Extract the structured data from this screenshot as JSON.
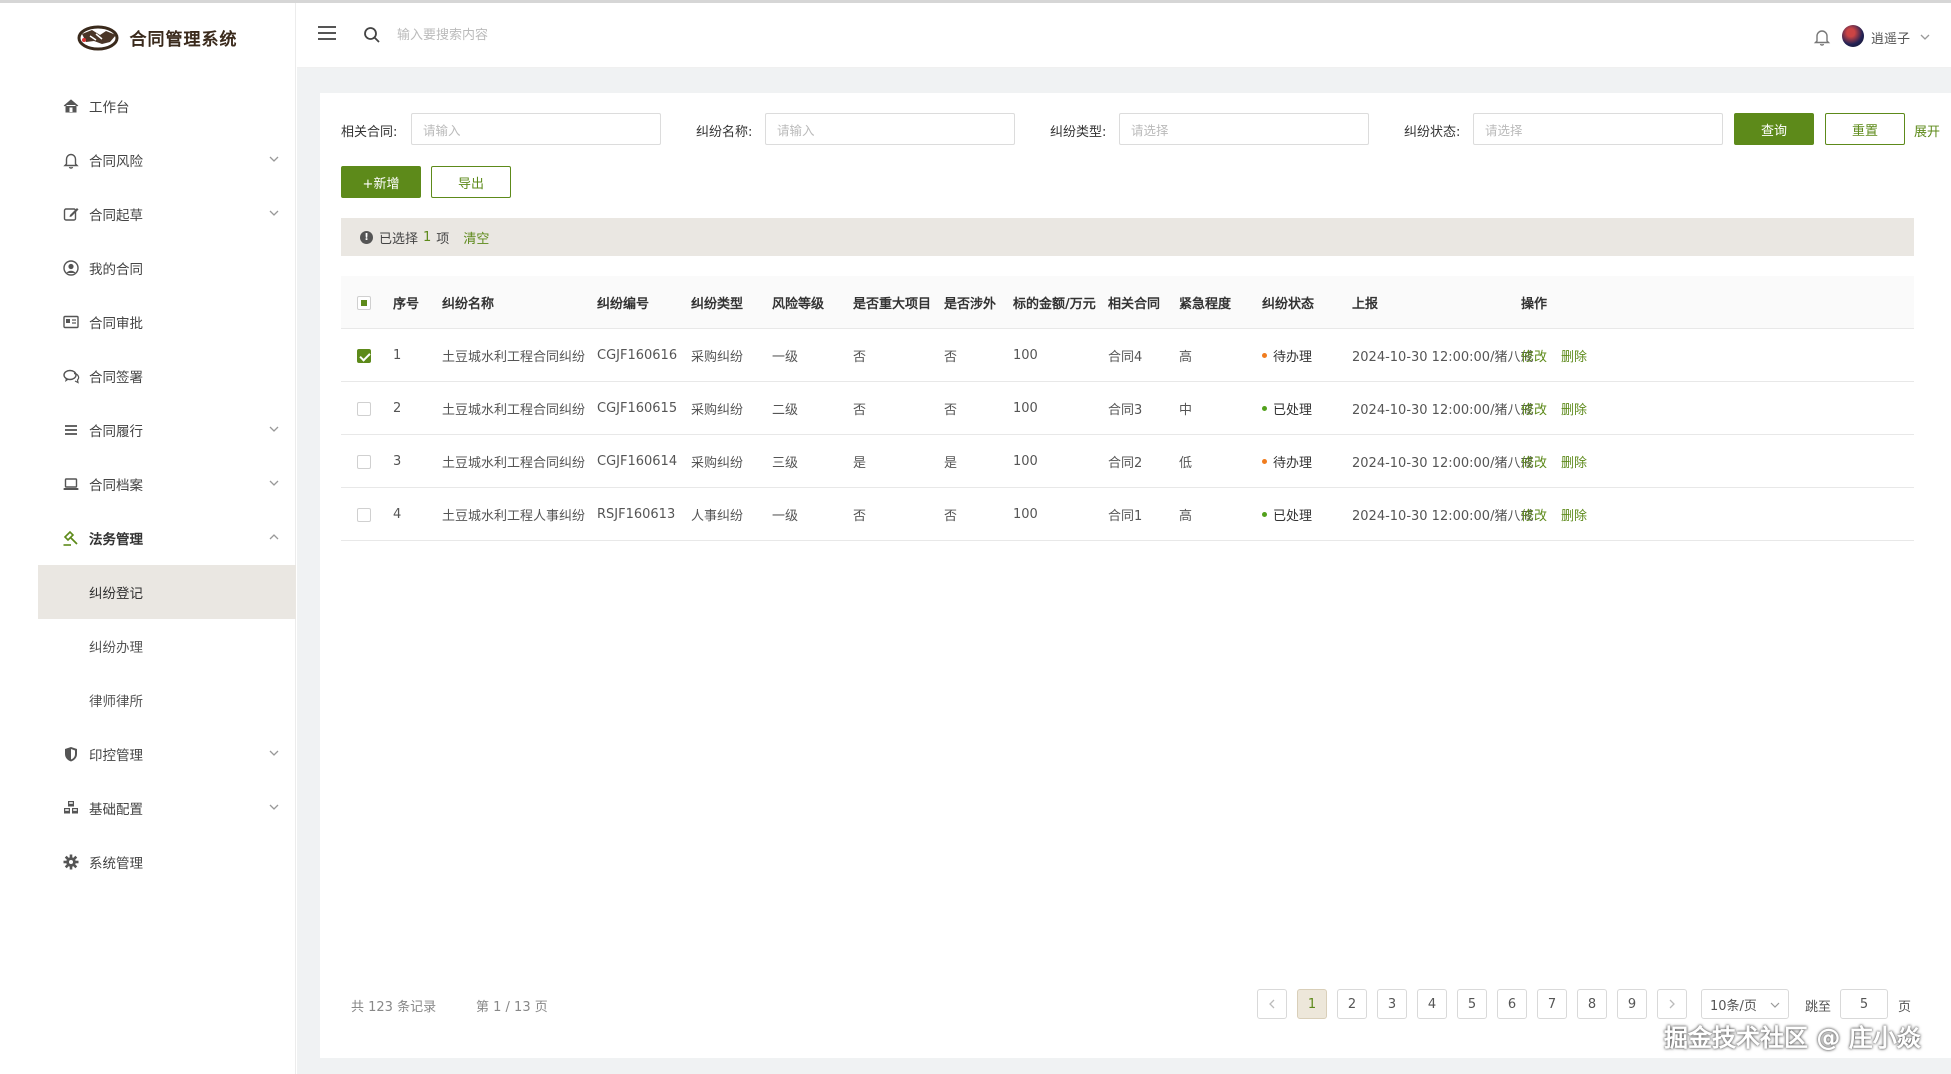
{
  "app": {
    "title": "合同管理系统"
  },
  "header": {
    "search_placeholder": "输入要搜索内容",
    "username": "逍遥子"
  },
  "sidebar": {
    "items": [
      {
        "label": "工作台",
        "icon": "home-icon",
        "expandable": false
      },
      {
        "label": "合同风险",
        "icon": "bell-icon",
        "expandable": true
      },
      {
        "label": "合同起草",
        "icon": "edit-icon",
        "expandable": true
      },
      {
        "label": "我的合同",
        "icon": "user-circle-icon",
        "expandable": false
      },
      {
        "label": "合同审批",
        "icon": "id-card-icon",
        "expandable": false
      },
      {
        "label": "合同签署",
        "icon": "chat-icon",
        "expandable": false
      },
      {
        "label": "合同履行",
        "icon": "list-icon",
        "expandable": true
      },
      {
        "label": "合同档案",
        "icon": "laptop-icon",
        "expandable": true
      },
      {
        "label": "法务管理",
        "icon": "gavel-icon",
        "expandable": true,
        "expanded": true
      },
      {
        "label": "印控管理",
        "icon": "shield-icon",
        "expandable": true
      },
      {
        "label": "基础配置",
        "icon": "cubes-icon",
        "expandable": true
      },
      {
        "label": "系统管理",
        "icon": "gear-icon",
        "expandable": false
      }
    ],
    "legal_sub": [
      "纠纷登记",
      "纠纷办理",
      "律师律所"
    ],
    "active_sub": "纠纷登记"
  },
  "filters": {
    "related_contract": {
      "label": "相关合同:",
      "placeholder": "请输入"
    },
    "dispute_name": {
      "label": "纠纷名称:",
      "placeholder": "请输入"
    },
    "dispute_type": {
      "label": "纠纷类型:",
      "placeholder": "请选择"
    },
    "dispute_status": {
      "label": "纠纷状态:",
      "placeholder": "请选择"
    },
    "query_label": "查询",
    "reset_label": "重置",
    "expand_label": "展开"
  },
  "toolbar": {
    "add_label": "+新增",
    "export_label": "导出"
  },
  "selection": {
    "prefix": "已选择",
    "count": "1",
    "suffix": "项",
    "clear_label": "清空"
  },
  "table": {
    "headers": [
      "序号",
      "纠纷名称",
      "纠纷编号",
      "纠纷类型",
      "风险等级",
      "是否重大项目",
      "是否涉外",
      "标的金额/万元",
      "相关合同",
      "紧急程度",
      "纠纷状态",
      "上报",
      "操作"
    ],
    "rows": [
      {
        "checked": true,
        "no": "1",
        "name": "土豆城水利工程合同纠纷",
        "code": "CGJF160616",
        "type": "采购纠纷",
        "risk": "一级",
        "major": "否",
        "foreign": "否",
        "amount": "100",
        "contract": "合同4",
        "urgency": "高",
        "status": "待办理",
        "status_color": "#f07c1e",
        "report": "2024-10-30 12:00:00/猪八戒",
        "edit": "修改",
        "delete": "删除"
      },
      {
        "checked": false,
        "no": "2",
        "name": "土豆城水利工程合同纠纷",
        "code": "CGJF160615",
        "type": "采购纠纷",
        "risk": "二级",
        "major": "否",
        "foreign": "否",
        "amount": "100",
        "contract": "合同3",
        "urgency": "中",
        "status": "已处理",
        "status_color": "#52a11c",
        "report": "2024-10-30 12:00:00/猪八戒",
        "edit": "修改",
        "delete": "删除"
      },
      {
        "checked": false,
        "no": "3",
        "name": "土豆城水利工程合同纠纷",
        "code": "CGJF160614",
        "type": "采购纠纷",
        "risk": "三级",
        "major": "是",
        "foreign": "是",
        "amount": "100",
        "contract": "合同2",
        "urgency": "低",
        "status": "待办理",
        "status_color": "#f07c1e",
        "report": "2024-10-30 12:00:00/猪八戒",
        "edit": "修改",
        "delete": "删除"
      },
      {
        "checked": false,
        "no": "4",
        "name": "土豆城水利工程人事纠纷",
        "code": "RSJF160613",
        "type": "人事纠纷",
        "risk": "一级",
        "major": "否",
        "foreign": "否",
        "amount": "100",
        "contract": "合同1",
        "urgency": "高",
        "status": "已处理",
        "status_color": "#52a11c",
        "report": "2024-10-30 12:00:00/猪八戒",
        "edit": "修改",
        "delete": "删除"
      }
    ]
  },
  "pagination": {
    "total_text": "共 123 条记录",
    "page_text": "第 1 / 13 页",
    "pages": [
      "1",
      "2",
      "3",
      "4",
      "5",
      "6",
      "7",
      "8",
      "9"
    ],
    "current": "1",
    "page_size": "10条/页",
    "jump_label": "跳至",
    "jump_value": "5",
    "jump_suffix": "页"
  },
  "watermark": "掘金技术社区 @ 庄小焱",
  "colors": {
    "primary": "#5d8a1a",
    "active_bg": "#eae7e2",
    "pending": "#f07c1e",
    "done": "#52a11c"
  }
}
